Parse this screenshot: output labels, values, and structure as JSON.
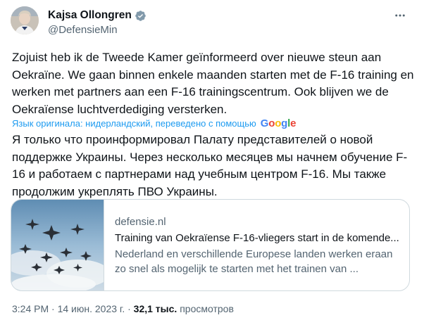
{
  "author": {
    "display_name": "Kajsa Ollongren",
    "handle": "@DefensieMin",
    "avatar_icon": "profile-photo",
    "verified_icon": "verified-badge-icon",
    "verified_color": "#829aab"
  },
  "tweet": {
    "text": "Zojuist heb ik de Tweede Kamer geïnformeerd over nieuwe steun aan Oekraïne. We gaan binnen enkele maanden starten met de F-16 training en werken met partners aan een F-16 trainingscentrum. Ook blijven we de Oekraïense luchtverdediging versterken.",
    "translation_notice": "Язык оригинала: нидерландский, переведено с помощью",
    "translation_provider": "Google",
    "translated_text": "Я только что проинформировал Палату представителей о новой поддержке Украины. Через несколько месяцев мы начнем обучение F-16 и работаем с партнерами над учебным центром F-16. Мы также продолжим укреплять ПВО Украины."
  },
  "card": {
    "domain": "defensie.nl",
    "title": "Training van Oekraïense F-16-vliegers start in de komende...",
    "description": "Nederland en verschillende Europese landen werken eraan zo snel als mogelijk te starten met het trainen van ..."
  },
  "meta": {
    "time": "3:24 PM",
    "separator": "·",
    "date": "14 июн. 2023 г.",
    "views_count": "32,1 тыс.",
    "views_label": "просмотров"
  },
  "colors": {
    "link_blue": "#1d9bf0",
    "secondary_text": "#536471",
    "border": "#cfd9de"
  }
}
